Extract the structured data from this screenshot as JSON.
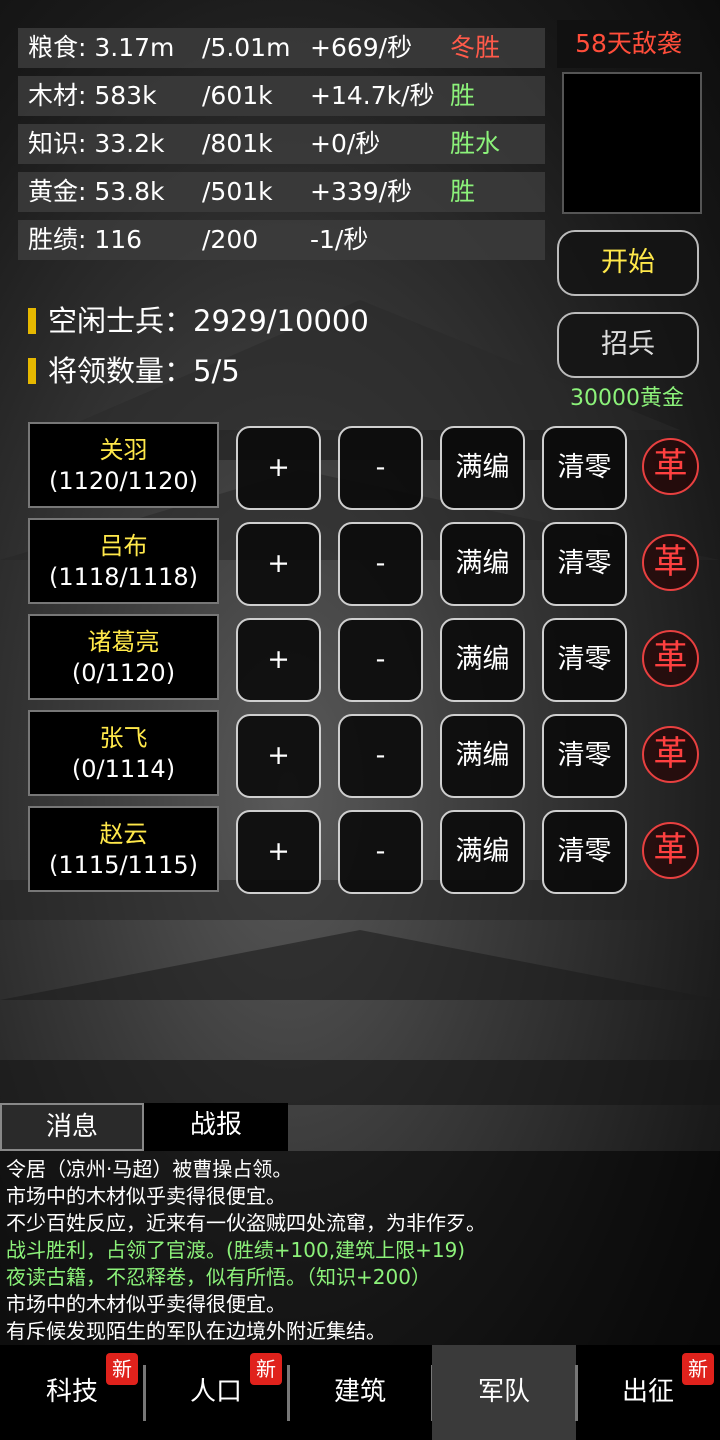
{
  "resources": [
    {
      "name": "粮食: 3.17m",
      "max": "/5.01m",
      "rate": "+669/秒",
      "tag": "冬胜",
      "tag_color": "#ff5a4a"
    },
    {
      "name": "木材: 583k",
      "max": "/601k",
      "rate": "+14.7k/秒",
      "tag": "胜",
      "tag_color": "#8cf27a"
    },
    {
      "name": "知识: 33.2k",
      "max": "/801k",
      "rate": "+0/秒",
      "tag": "胜水",
      "tag_color": "#8cf27a"
    },
    {
      "name": "黄金: 53.8k",
      "max": "/501k",
      "rate": "+339/秒",
      "tag": "胜",
      "tag_color": "#8cf27a"
    },
    {
      "name": "胜绩: 116",
      "max": "/200",
      "rate": "-1/秒",
      "tag": "",
      "tag_color": ""
    }
  ],
  "enemy_countdown": "58天敌袭",
  "start_label": "开始",
  "recruit": {
    "label": "招兵",
    "cost": "30000黄金"
  },
  "info": {
    "idle_soldiers": "空闲士兵：2929/10000",
    "generals_count": "将领数量：5/5"
  },
  "generals": [
    {
      "name": "关羽",
      "troops": "(1120/1120)"
    },
    {
      "name": "吕布",
      "troops": "(1118/1118)"
    },
    {
      "name": "诸葛亮",
      "troops": "(0/1120)"
    },
    {
      "name": "张飞",
      "troops": "(0/1114)"
    },
    {
      "name": "赵云",
      "troops": "(1115/1115)"
    }
  ],
  "general_actions": {
    "plus": "+",
    "minus": "-",
    "full": "满编",
    "clear": "清零",
    "revoke": "革"
  },
  "message_tabs": {
    "messages": "消息",
    "battle_report": "战报"
  },
  "log": [
    {
      "text": "令居（凉州·马超）被曹操占领。",
      "color": "#ffffff"
    },
    {
      "text": "市场中的木材似乎卖得很便宜。",
      "color": "#ffffff"
    },
    {
      "text": "不少百姓反应，近来有一伙盗贼四处流窜，为非作歹。",
      "color": "#ffffff"
    },
    {
      "text": "战斗胜利，占领了官渡。(胜绩+100,建筑上限+19)",
      "color": "#8cf27a"
    },
    {
      "text": "夜读古籍，不忍释卷，似有所悟。（知识+200）",
      "color": "#8cf27a"
    },
    {
      "text": "市场中的木材似乎卖得很便宜。",
      "color": "#ffffff"
    },
    {
      "text": "有斥候发现陌生的军队在边境外附近集结。",
      "color": "#ffffff"
    }
  ],
  "nav": [
    {
      "label": "科技",
      "badge": "新",
      "active": false
    },
    {
      "label": "人口",
      "badge": "新",
      "active": false
    },
    {
      "label": "建筑",
      "badge": "",
      "active": false
    },
    {
      "label": "军队",
      "badge": "",
      "active": true
    },
    {
      "label": "出征",
      "badge": "新",
      "active": false
    }
  ]
}
